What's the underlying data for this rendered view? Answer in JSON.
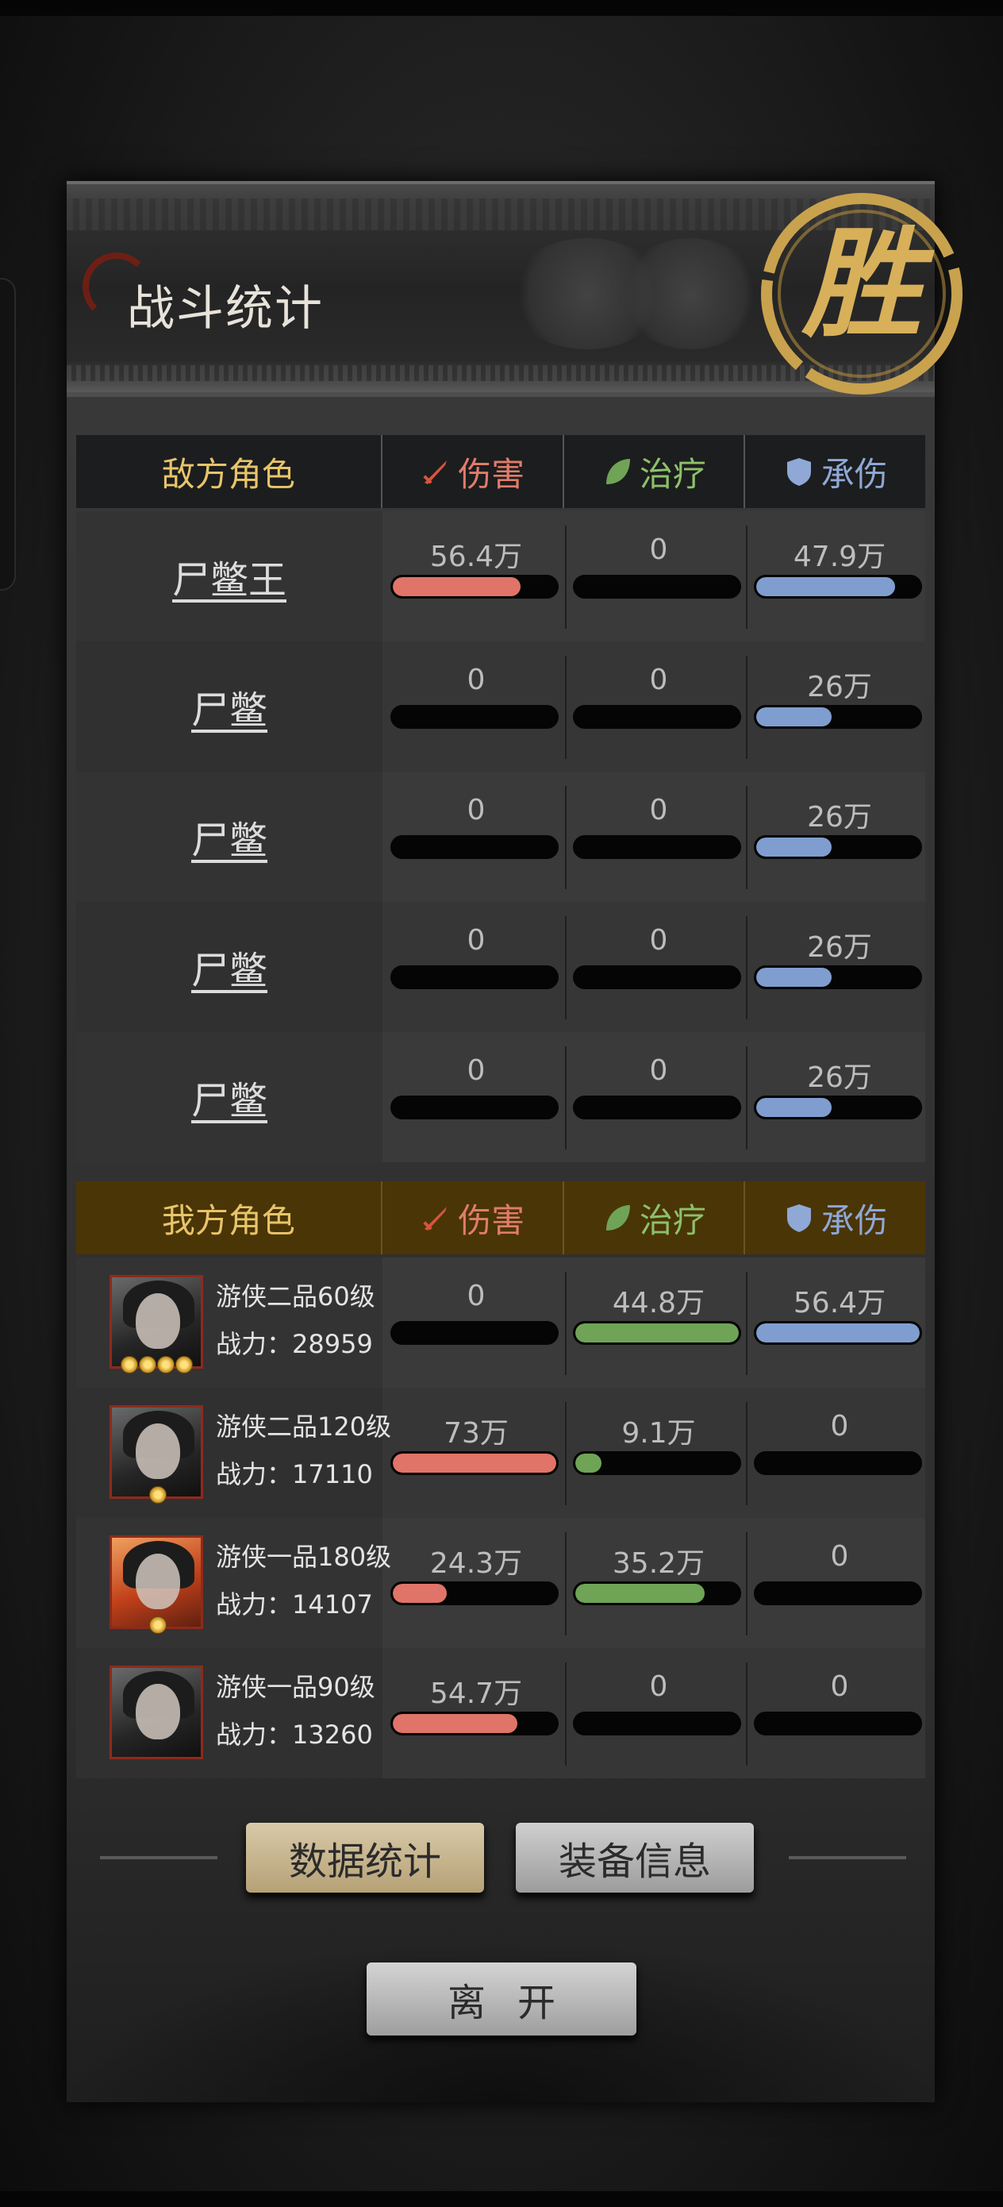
{
  "header": {
    "title": "战斗统计",
    "result_seal": "胜"
  },
  "columns": {
    "damage": "伤害",
    "heal": "治疗",
    "taken": "承伤"
  },
  "colors": {
    "damage": "#e07468",
    "heal": "#6fa456",
    "taken": "#7f9ecf",
    "enemy_header_title": "#e8c46a"
  },
  "enemy": {
    "header": "敌方角色",
    "rows": [
      {
        "name": "尸鳖王",
        "damage": "56.4万",
        "damage_frac": 0.78,
        "heal": "0",
        "heal_frac": 0,
        "taken": "47.9万",
        "taken_frac": 0.85
      },
      {
        "name": "尸鳖",
        "damage": "0",
        "damage_frac": 0,
        "heal": "0",
        "heal_frac": 0,
        "taken": "26万",
        "taken_frac": 0.46
      },
      {
        "name": "尸鳖",
        "damage": "0",
        "damage_frac": 0,
        "heal": "0",
        "heal_frac": 0,
        "taken": "26万",
        "taken_frac": 0.46
      },
      {
        "name": "尸鳖",
        "damage": "0",
        "damage_frac": 0,
        "heal": "0",
        "heal_frac": 0,
        "taken": "26万",
        "taken_frac": 0.46
      },
      {
        "name": "尸鳖",
        "damage": "0",
        "damage_frac": 0,
        "heal": "0",
        "heal_frac": 0,
        "taken": "26万",
        "taken_frac": 0.46
      }
    ]
  },
  "ally": {
    "header": "我方角色",
    "rows": [
      {
        "name": "游侠二品60级",
        "power": "战力：28959",
        "damage": "0",
        "damage_frac": 0,
        "heal": "44.8万",
        "heal_frac": 1.0,
        "taken": "56.4万",
        "taken_frac": 1.0,
        "stars": 4
      },
      {
        "name": "游侠二品120级",
        "power": "战力：17110",
        "damage": "73万",
        "damage_frac": 1.0,
        "heal": "9.1万",
        "heal_frac": 0.16,
        "taken": "0",
        "taken_frac": 0,
        "stars": 1
      },
      {
        "name": "游侠一品180级",
        "power": "战力：14107",
        "damage": "24.3万",
        "damage_frac": 0.33,
        "heal": "35.2万",
        "heal_frac": 0.79,
        "taken": "0",
        "taken_frac": 0,
        "stars": 1
      },
      {
        "name": "游侠一品90级",
        "power": "战力：13260",
        "damage": "54.7万",
        "damage_frac": 0.76,
        "heal": "0",
        "heal_frac": 0,
        "taken": "0",
        "taken_frac": 0,
        "stars": 0
      }
    ]
  },
  "tabs": {
    "stats": "数据统计",
    "equipment": "装备信息"
  },
  "leave_button": "离开"
}
